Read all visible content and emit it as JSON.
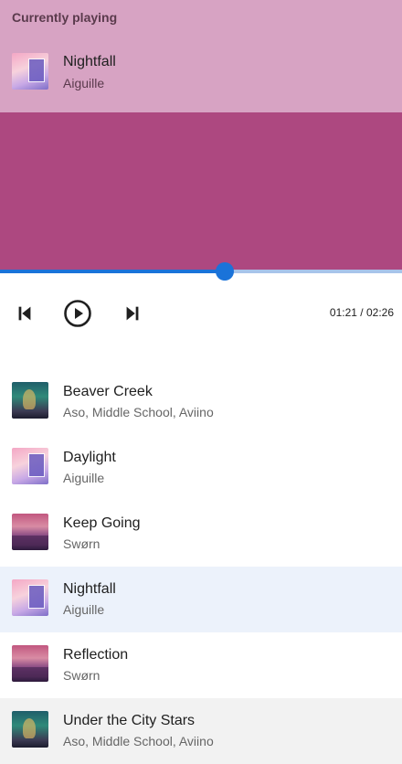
{
  "now_playing": {
    "label": "Currently playing",
    "title": "Nightfall",
    "artist": "Aiguille",
    "artwork": "nightfall-cover"
  },
  "player": {
    "progress_fraction": 0.56,
    "elapsed": "01:21",
    "separator": " / ",
    "duration": "02:26",
    "accent_color": "#1a73d9",
    "visual_color": "#ad4880",
    "header_color": "#d7a3c3"
  },
  "controls": {
    "previous_icon": "skip-previous-icon",
    "play_icon": "play-circle-icon",
    "next_icon": "skip-next-icon"
  },
  "playlist": [
    {
      "title": "Beaver Creek",
      "artist": "Aso, Middle School, Aviino",
      "artwork": "art-green"
    },
    {
      "title": "Daylight",
      "artist": "Aiguille",
      "artwork": "art-pink"
    },
    {
      "title": "Keep Going",
      "artist": "Swørn",
      "artwork": "art-purple"
    },
    {
      "title": "Nightfall",
      "artist": "Aiguille",
      "artwork": "art-pink",
      "selected": true
    },
    {
      "title": "Reflection",
      "artist": "Swørn",
      "artwork": "art-purple"
    },
    {
      "title": "Under the City Stars",
      "artist": "Aso, Middle School, Aviino",
      "artwork": "art-green",
      "hovered": true
    }
  ]
}
